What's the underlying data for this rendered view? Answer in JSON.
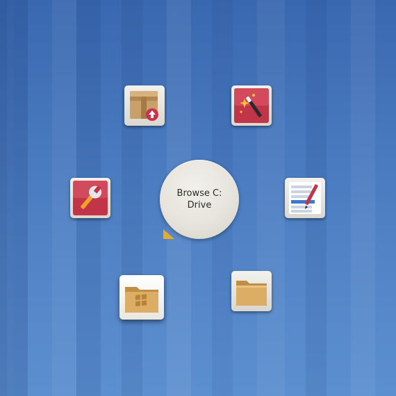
{
  "pie_menu": {
    "center_label": "Browse C: Drive",
    "items": [
      {
        "icon": "package-install-icon"
      },
      {
        "icon": "magic-wand-icon"
      },
      {
        "icon": "wrench-settings-icon"
      },
      {
        "icon": "text-editor-icon"
      },
      {
        "icon": "windows-folder-icon"
      },
      {
        "icon": "folder-icon"
      }
    ]
  },
  "colors": {
    "desktop_background": "#4f80c4",
    "pointer": "#e4ab2f",
    "red_tile": "#c8324a",
    "folder": "#d9a85a"
  }
}
